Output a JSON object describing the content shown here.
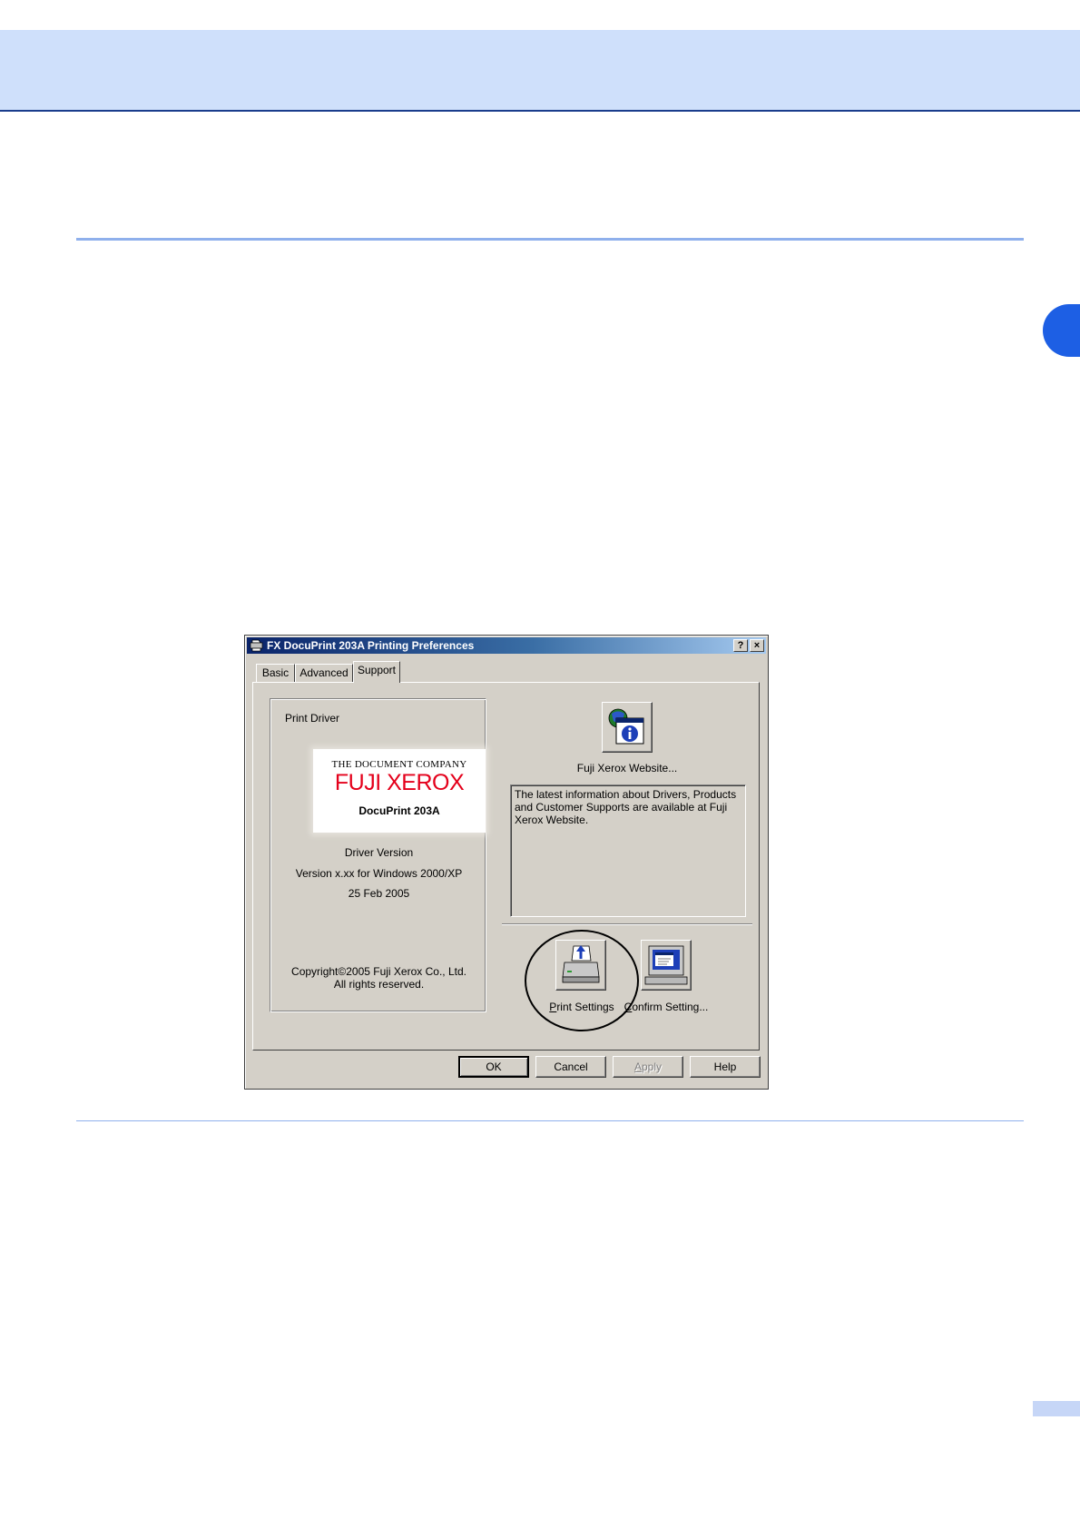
{
  "dialog": {
    "title": "FX DocuPrint 203A Printing Preferences",
    "help_button": "?",
    "close_button": "×"
  },
  "tabs": [
    {
      "label": "Basic"
    },
    {
      "label": "Advanced"
    },
    {
      "label": "Support",
      "selected": true
    }
  ],
  "print_driver": {
    "group_label": "Print Driver",
    "logo": {
      "tagline": "THE DOCUMENT COMPANY",
      "brand": "FUJI XEROX",
      "model": "DocuPrint 203A",
      "brand_color": "#e4001b"
    },
    "driver_version_label": "Driver Version",
    "version_text": "Version x.xx for Windows 2000/XP",
    "date": "25 Feb 2005",
    "copyright_line1": "Copyright©2005 Fuji Xerox Co., Ltd.",
    "copyright_line2": "All rights reserved."
  },
  "website": {
    "button_icon": "info-globe-icon",
    "label": "Fuji Xerox Website...",
    "info_text": "The latest information about Drivers, Products and Customer Supports are available at Fuji Xerox Website."
  },
  "print_settings": {
    "icon": "printer-icon",
    "label_first": "P",
    "label_rest": "rint Settings"
  },
  "confirm_setting": {
    "icon": "computer-monitor-icon",
    "label_first": "C",
    "label_rest": "onfirm Setting..."
  },
  "buttons": {
    "ok": "OK",
    "cancel": "Cancel",
    "apply_first": "A",
    "apply_rest": "pply",
    "help": "Help"
  }
}
